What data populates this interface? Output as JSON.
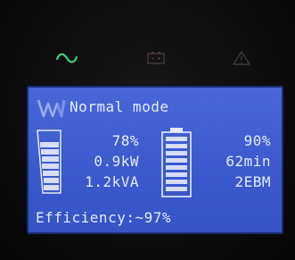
{
  "indicators": {
    "ac_icon": "ac-wave-icon",
    "battery_icon": "battery-icon",
    "warning_icon": "warning-icon",
    "ac_color": "#3ad17a",
    "battery_color": "#4a3a3a",
    "warning_color": "#3a3a3a"
  },
  "lcd": {
    "background": "#3f5fd0",
    "mode_label": "Normal mode",
    "load": {
      "percent_label": "78%",
      "power_label": "0.9kW",
      "apparent_label": "1.2kVA",
      "level": 0.78
    },
    "battery": {
      "percent_label": "90%",
      "runtime_label": "62min",
      "ebm_label": "2EBM",
      "level": 0.9
    },
    "efficiency_label": "Efficiency:~97%"
  }
}
